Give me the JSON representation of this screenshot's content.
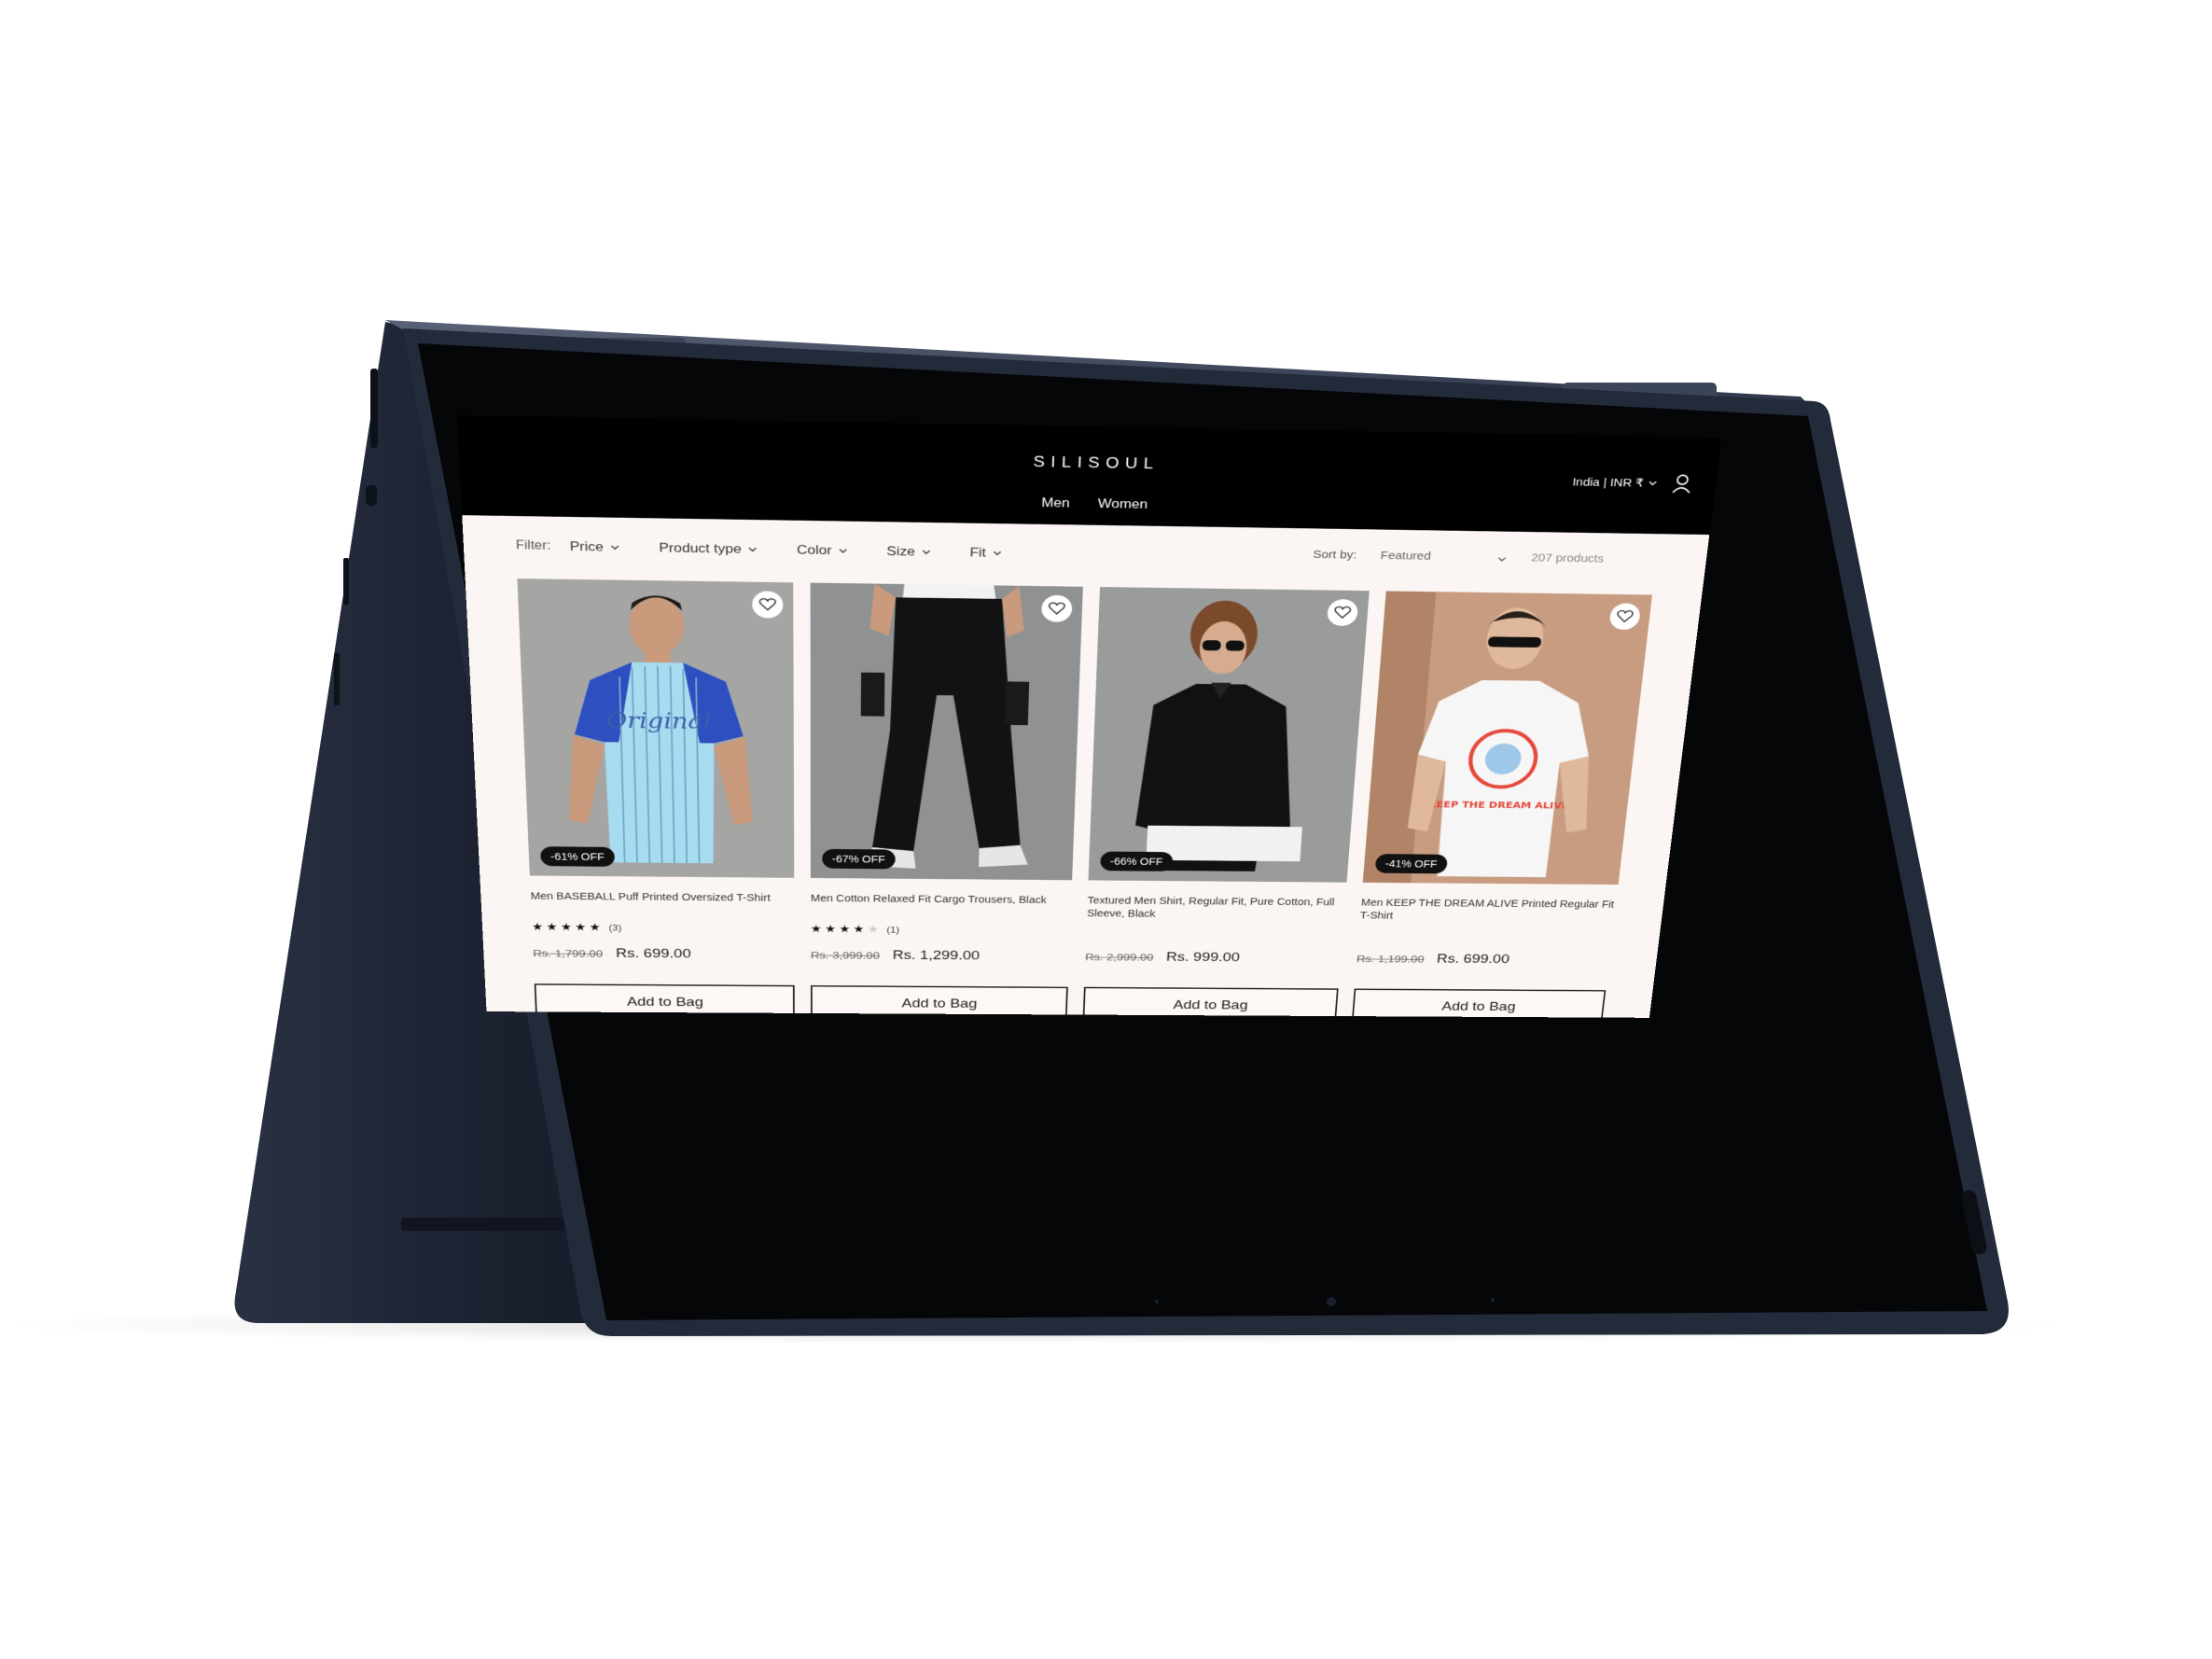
{
  "store": {
    "brand": "SILISOUL",
    "nav": [
      "Men",
      "Women"
    ],
    "locale": "India | INR ₹"
  },
  "filters": {
    "label": "Filter:",
    "items": [
      "Price",
      "Product type",
      "Color",
      "Size",
      "Fit"
    ],
    "sort_label": "Sort by:",
    "sort_value": "Featured",
    "product_count": "207 products"
  },
  "products": [
    {
      "title": "Men BASEBALL Puff Printed Oversized T-Shirt",
      "discount": "-61% OFF",
      "rating_stars": 5,
      "rating_count": "(3)",
      "compare_price": "Rs. 1,799.00",
      "price": "Rs. 699.00",
      "button": "Add to Bag"
    },
    {
      "title": "Men Cotton Relaxed Fit Cargo Trousers, Black",
      "discount": "-67% OFF",
      "rating_stars": 4,
      "rating_count": "(1)",
      "compare_price": "Rs. 3,999.00",
      "price": "Rs. 1,299.00",
      "button": "Add to Bag"
    },
    {
      "title": "Textured Men Shirt, Regular Fit, Pure Cotton, Full Sleeve, Black",
      "discount": "-66% OFF",
      "compare_price": "Rs. 2,999.00",
      "price": "Rs. 999.00",
      "button": "Add to Bag"
    },
    {
      "title": "Men KEEP THE DREAM ALIVE Printed Regular Fit T-Shirt",
      "discount": "-41% OFF",
      "compare_price": "Rs. 1,199.00",
      "price": "Rs. 699.00",
      "button": "Add to Bag"
    }
  ],
  "colors": {
    "device_body": "#1e2433",
    "header_bg": "#000000",
    "page_bg": "#fbf6f3"
  }
}
